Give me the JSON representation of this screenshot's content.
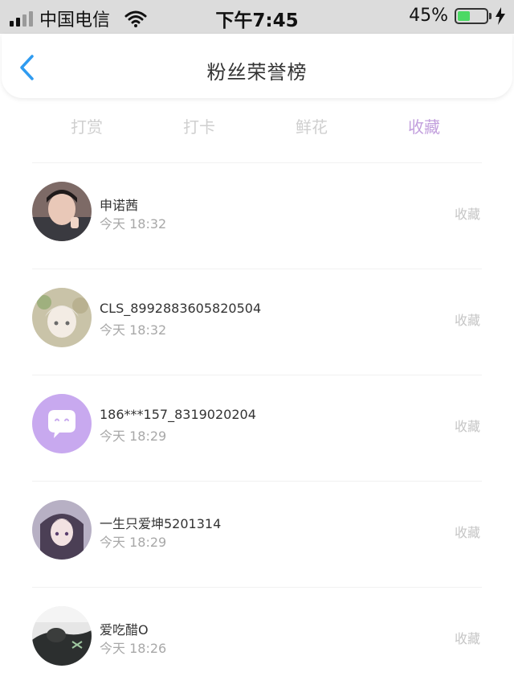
{
  "status_bar": {
    "carrier": "中国电信",
    "time": "下午7:45",
    "battery": "45%",
    "battery_level": 0.45
  },
  "header": {
    "title": "粉丝荣誉榜",
    "back_icon": "chevron-left-icon"
  },
  "tabs": [
    {
      "label": "打赏",
      "active": false
    },
    {
      "label": "打卡",
      "active": false
    },
    {
      "label": "鲜花",
      "active": false
    },
    {
      "label": "收藏",
      "active": true
    }
  ],
  "colors": {
    "accent": "#c29fdd",
    "back_arrow": "#2f9bf0",
    "inactive_tab": "#cfcfcf"
  },
  "fans": [
    {
      "name": "申诺茜",
      "time": "今天 18:32",
      "action": "收藏",
      "avatar": "photo-avatar"
    },
    {
      "name": "CLS_8992883605820504",
      "time": "今天 18:32",
      "action": "收藏",
      "avatar": "anime-avatar"
    },
    {
      "name": "186***157_8319020204",
      "time": "今天 18:29",
      "action": "收藏",
      "avatar": "default-chat-avatar"
    },
    {
      "name": "一生只爱坤5201314",
      "time": "今天 18:29",
      "action": "收藏",
      "avatar": "anime-avatar"
    },
    {
      "name": "爱吃醋O",
      "time": "今天 18:26",
      "action": "收藏",
      "avatar": "photo-avatar"
    }
  ]
}
